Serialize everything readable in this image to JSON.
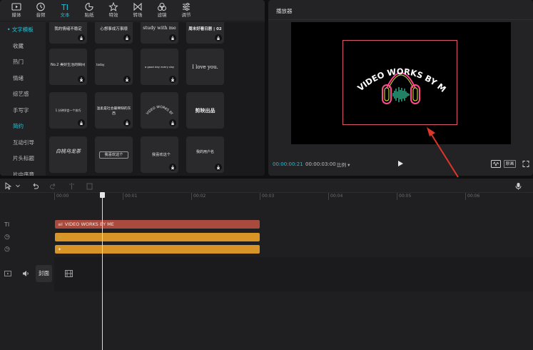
{
  "toolbar": {
    "tabs": [
      {
        "label": "媒体",
        "icon": "media-icon"
      },
      {
        "label": "音频",
        "icon": "audio-icon"
      },
      {
        "label": "文本",
        "icon": "text-icon",
        "active": true
      },
      {
        "label": "贴纸",
        "icon": "sticker-icon"
      },
      {
        "label": "特效",
        "icon": "effects-icon"
      },
      {
        "label": "转场",
        "icon": "transition-icon"
      },
      {
        "label": "滤镜",
        "icon": "filter-icon"
      },
      {
        "label": "调节",
        "icon": "adjust-icon"
      }
    ],
    "accent": "#22c0d6"
  },
  "sidebar": {
    "items": [
      {
        "label": "• 文字模板",
        "active": true
      },
      {
        "label": "收藏"
      },
      {
        "label": "热门"
      },
      {
        "label": "情绪"
      },
      {
        "label": "综艺感"
      },
      {
        "label": "手写字"
      },
      {
        "label": "简约",
        "highlight": true
      },
      {
        "label": "互动引导"
      },
      {
        "label": "片头标题"
      },
      {
        "label": "片中序章"
      }
    ]
  },
  "templates": [
    {
      "text": "我的情绪不稳定"
    },
    {
      "text": "心想事成万事顺"
    },
    {
      "text": "study with me"
    },
    {
      "text": "周末好看日剧 | 02"
    },
    {
      "text": "No.2 美好生活的瞬间"
    },
    {
      "text": "today"
    },
    {
      "text": "a good day every day"
    },
    {
      "text": "I love you."
    },
    {
      "text": "1 分钟学会一个技巧"
    },
    {
      "text": "温柔是社会最稀缺的东西"
    },
    {
      "text": "VIDEO WORKS BY ME"
    },
    {
      "text": "剪映出品"
    },
    {
      "text": "白桃乌龙茶"
    },
    {
      "text": "我喜欢这个"
    },
    {
      "text": "我喜欢这个"
    },
    {
      "text": "我的用户名"
    }
  ],
  "player": {
    "title": "播放器",
    "video_text": "VIDEO WORKS BY ME",
    "current_time": "00:00:00:21",
    "total_time": "00:00:03:00",
    "ratio_label": "比例",
    "original_label": "原画",
    "icons": [
      "play-icon",
      "waveform-icon",
      "fullscreen-icon"
    ]
  },
  "timeline": {
    "ticks": [
      "00:00",
      "00:01",
      "00:02",
      "00:03",
      "00:04",
      "00:05",
      "00:06"
    ],
    "tracks": [
      {
        "type": "text",
        "label": "VIDEO WORKS BY ME",
        "icon_text": "TI"
      },
      {
        "type": "effect",
        "label": "",
        "icon_text": "◷"
      },
      {
        "type": "effect",
        "label": "",
        "icon_text": "◷"
      }
    ],
    "cover_label": "封面",
    "colors": {
      "text_clip": "#a84a3d",
      "effect_clip": "#d89427"
    }
  }
}
